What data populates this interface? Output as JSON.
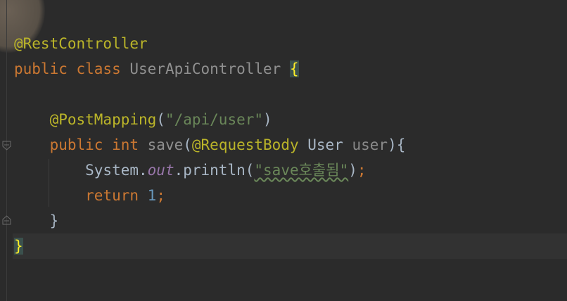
{
  "editor": {
    "lines": [
      {
        "tokens": [
          {
            "cls": "ann",
            "text": "@RestController"
          }
        ]
      },
      {
        "tokens": [
          {
            "cls": "kw",
            "text": "public class "
          },
          {
            "cls": "cls",
            "text": "UserApiController "
          },
          {
            "cls": "brace-match",
            "text": "{"
          }
        ]
      },
      {
        "tokens": []
      },
      {
        "tokens": [
          {
            "cls": "plain",
            "text": "    "
          },
          {
            "cls": "ann",
            "text": "@PostMapping"
          },
          {
            "cls": "plain",
            "text": "("
          },
          {
            "cls": "str",
            "text": "\"/api/user\""
          },
          {
            "cls": "plain",
            "text": ")"
          }
        ]
      },
      {
        "tokens": [
          {
            "cls": "plain",
            "text": "    "
          },
          {
            "cls": "kw",
            "text": "public int "
          },
          {
            "cls": "cls",
            "text": "save"
          },
          {
            "cls": "plain",
            "text": "("
          },
          {
            "cls": "ann",
            "text": "@RequestBody "
          },
          {
            "cls": "plain",
            "text": "User "
          },
          {
            "cls": "param",
            "text": "user"
          },
          {
            "cls": "plain",
            "text": "){"
          }
        ]
      },
      {
        "tokens": [
          {
            "cls": "plain",
            "text": "        System."
          },
          {
            "cls": "static",
            "text": "out"
          },
          {
            "cls": "plain",
            "text": ".println("
          },
          {
            "cls": "str typo",
            "text": "\"save호출됨\""
          },
          {
            "cls": "plain",
            "text": ")"
          },
          {
            "cls": "kw",
            "text": ";"
          }
        ]
      },
      {
        "tokens": [
          {
            "cls": "plain",
            "text": "        "
          },
          {
            "cls": "kw",
            "text": "return "
          },
          {
            "cls": "num",
            "text": "1"
          },
          {
            "cls": "kw",
            "text": ";"
          }
        ]
      },
      {
        "tokens": [
          {
            "cls": "plain",
            "text": "    }"
          }
        ]
      },
      {
        "tokens": [
          {
            "cls": "brace-match",
            "text": "}"
          }
        ]
      }
    ]
  },
  "colors": {
    "background": "#2b2b2b",
    "annotation": "#bbb529",
    "keyword": "#cc7832",
    "string": "#6a8759",
    "number": "#6897bb",
    "static_field": "#9876aa",
    "brace_match": "#ffef28"
  },
  "icons": {
    "fold_marker": "fold-marker-icon"
  }
}
